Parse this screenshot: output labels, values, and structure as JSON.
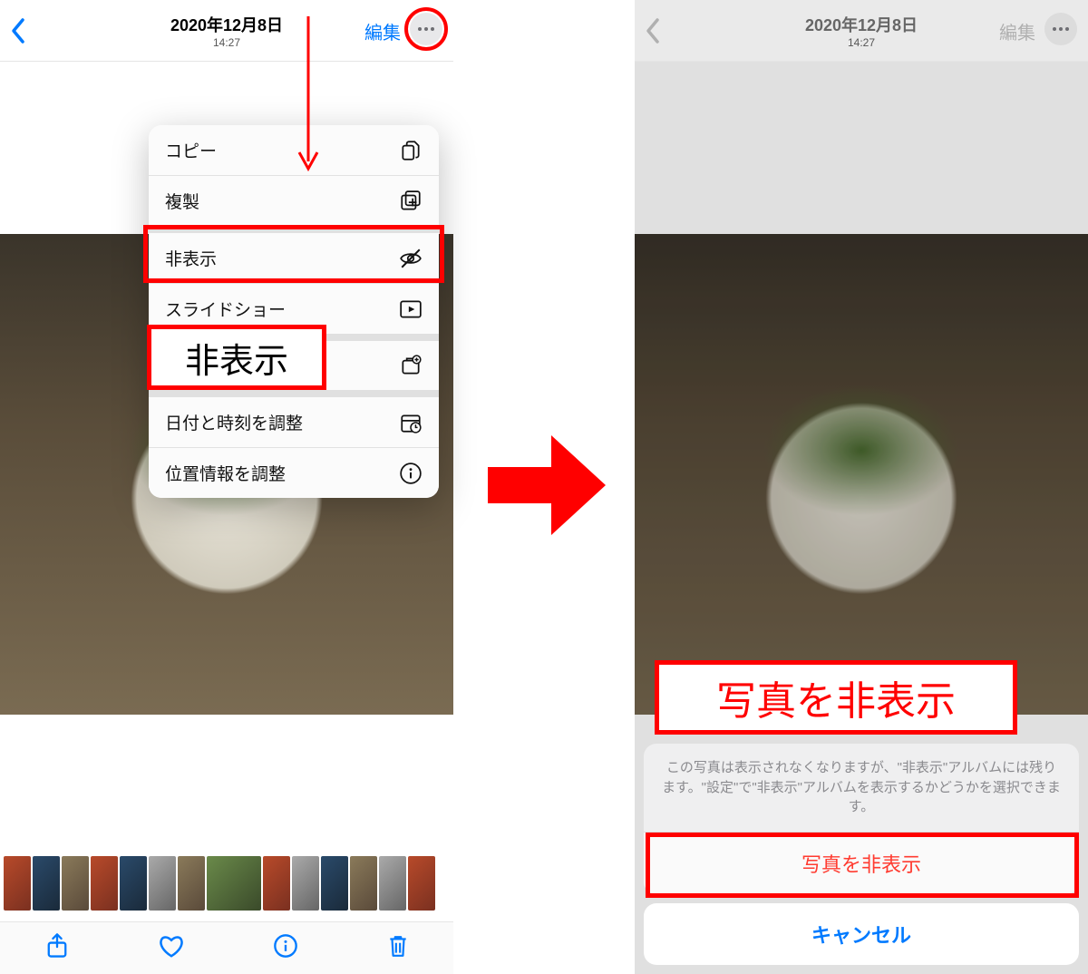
{
  "header": {
    "date": "2020年12月8日",
    "time": "14:27",
    "edit": "編集"
  },
  "menu": {
    "copy": "コピー",
    "duplicate": "複製",
    "hide": "非表示",
    "slideshow": "スライドショー",
    "album": "",
    "adjust_date": "日付と時刻を調整",
    "adjust_location": "位置情報を調整"
  },
  "callout": {
    "hide": "非表示",
    "hide_photo": "写真を非表示"
  },
  "sheet": {
    "message": "この写真は表示されなくなりますが、\"非表示\"アルバムには残ります。\"設定\"で\"非表示\"アルバムを表示するかどうかを選択できます。",
    "hide_button": "写真を非表示",
    "cancel": "キャンセル"
  }
}
